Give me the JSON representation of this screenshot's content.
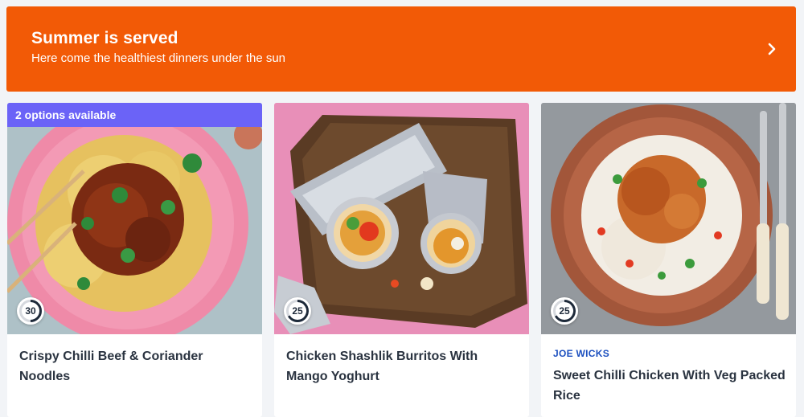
{
  "banner": {
    "title": "Summer is served",
    "subtitle": "Here come the healthiest dinners under the sun",
    "chevron_icon": "chevron-right-icon",
    "background": "#f25a06"
  },
  "recipes": [
    {
      "options_badge": "2 options available",
      "cook_time": "30",
      "title": "Crispy Chilli Beef & Coriander Noodles",
      "brand": ""
    },
    {
      "options_badge": "",
      "cook_time": "25",
      "title": "Chicken Shashlik Burritos With Mango Yoghurt",
      "brand": ""
    },
    {
      "options_badge": "",
      "cook_time": "25",
      "title": "Sweet Chilli Chicken With Veg Packed Rice",
      "brand": "JOE WICKS"
    }
  ],
  "colors": {
    "accent_orange": "#f25a06",
    "badge_purple": "#6b63f7",
    "brand_blue": "#1b4fbf",
    "page_bg": "#f2f4f7"
  }
}
